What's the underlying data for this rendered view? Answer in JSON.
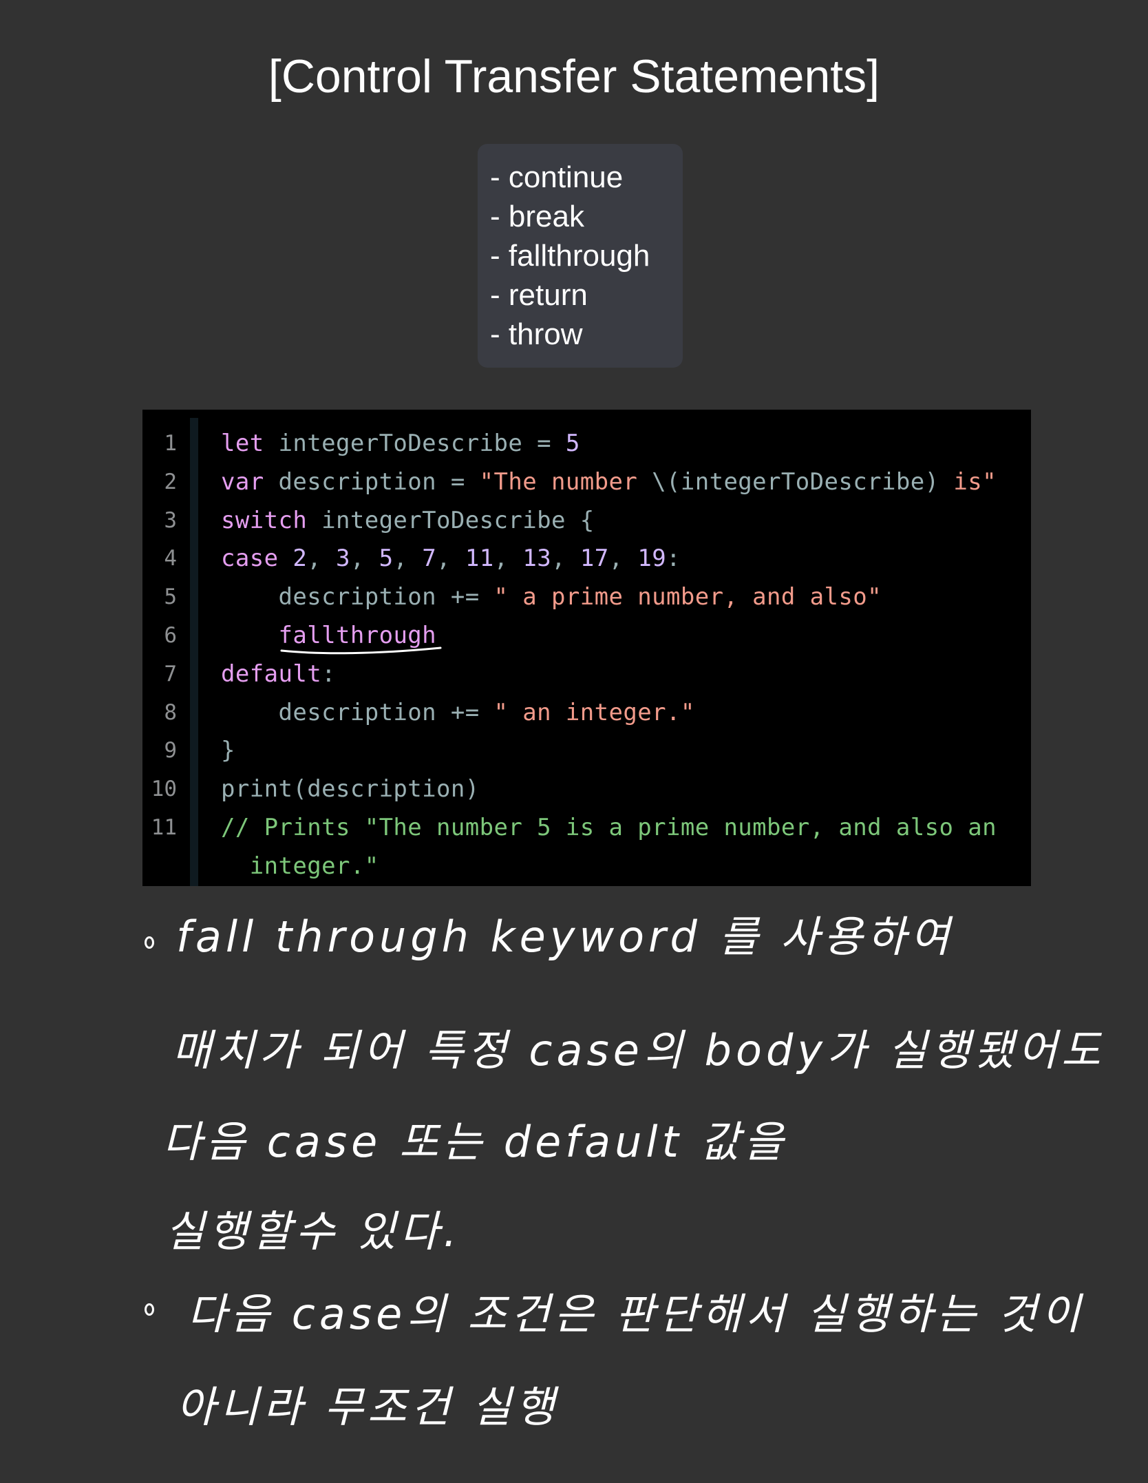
{
  "title": "[Control Transfer Statements]",
  "keywords": [
    "- continue",
    "- break",
    "- fallthrough",
    "- return",
    "- throw"
  ],
  "code": {
    "line_numbers": [
      "1",
      "2",
      "3",
      "4",
      "5",
      "6",
      "7",
      "8",
      "9",
      "10",
      "11"
    ],
    "lines": [
      [
        [
          "k",
          "let"
        ],
        [
          "p",
          " integerToDescribe = "
        ],
        [
          "n",
          "5"
        ]
      ],
      [
        [
          "k",
          "var"
        ],
        [
          "p",
          " description = "
        ],
        [
          "s",
          "\"The number "
        ],
        [
          "p",
          "\\(integerToDescribe)"
        ],
        [
          "s",
          " is\""
        ]
      ],
      [
        [
          "k",
          "switch"
        ],
        [
          "p",
          " integerToDescribe {"
        ]
      ],
      [
        [
          "k",
          "case"
        ],
        [
          "p",
          " "
        ],
        [
          "n",
          "2"
        ],
        [
          "p",
          ", "
        ],
        [
          "n",
          "3"
        ],
        [
          "p",
          ", "
        ],
        [
          "n",
          "5"
        ],
        [
          "p",
          ", "
        ],
        [
          "n",
          "7"
        ],
        [
          "p",
          ", "
        ],
        [
          "n",
          "11"
        ],
        [
          "p",
          ", "
        ],
        [
          "n",
          "13"
        ],
        [
          "p",
          ", "
        ],
        [
          "n",
          "17"
        ],
        [
          "p",
          ", "
        ],
        [
          "n",
          "19"
        ],
        [
          "p",
          ":"
        ]
      ],
      [
        [
          "p",
          "    description += "
        ],
        [
          "s",
          "\" a prime number, and also\""
        ]
      ],
      [
        [
          "p",
          "    "
        ],
        [
          "k",
          "fallthrough"
        ]
      ],
      [
        [
          "k",
          "default"
        ],
        [
          "p",
          ":"
        ]
      ],
      [
        [
          "p",
          "    description += "
        ],
        [
          "s",
          "\" an integer.\""
        ]
      ],
      [
        [
          "p",
          "}"
        ]
      ],
      [
        [
          "p",
          "print(description)"
        ]
      ],
      [
        [
          "c",
          "// Prints \"The number 5 is a prime number, and also an"
        ]
      ],
      [
        [
          "c",
          "  integer.\""
        ]
      ]
    ]
  },
  "notes": {
    "line1": "fall through keyword 를 사용하여",
    "line2": "매치가 되어 특정 case의 body가 실행됐어도",
    "line3": "다음 case 또는 default 값을",
    "line4": "실행할수 있다.",
    "line5": "다음 case의 조건은 판단해서 실행하는 것이",
    "line6": "아니라 무조건 실행"
  }
}
